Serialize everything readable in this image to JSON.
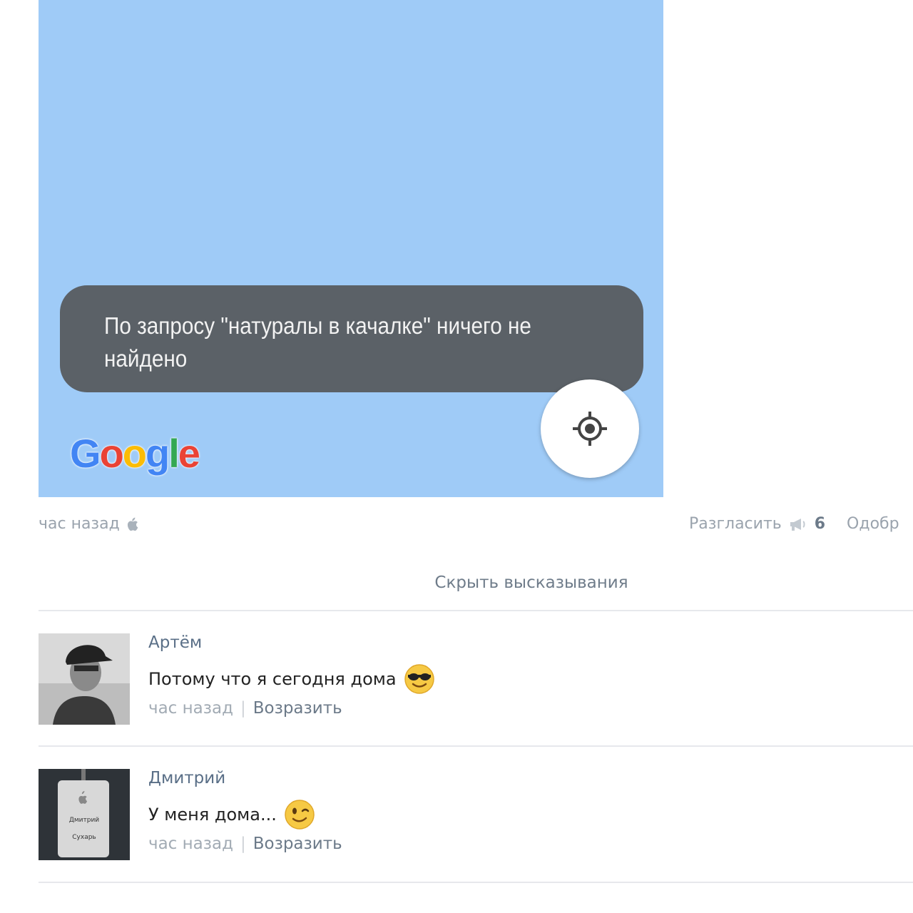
{
  "post": {
    "snackbar_text": "По запросу \"натуралы в качалке\" ничего не найдено",
    "google_logo": [
      "G",
      "o",
      "o",
      "g",
      "l",
      "e"
    ],
    "google_colors": [
      "#4285f4",
      "#ea4335",
      "#fbbc05",
      "#4285f4",
      "#34a853",
      "#ea4335"
    ],
    "time": "час назад",
    "share_label": "Разгласить",
    "share_count": "6",
    "like_label": "Одобр",
    "hide_comments": "Скрыть высказывания"
  },
  "comments": [
    {
      "author": "Артём",
      "text": "Потому что я сегодня дома",
      "emoji": "sunglasses-face",
      "time": "час назад",
      "reply": "Возразить"
    },
    {
      "author": "Дмитрий",
      "text": "У меня дома...",
      "emoji": "winking-face",
      "time": "час назад",
      "reply": "Возразить",
      "badge_line1": "Дмитрий",
      "badge_line2": "Сухарь"
    }
  ]
}
